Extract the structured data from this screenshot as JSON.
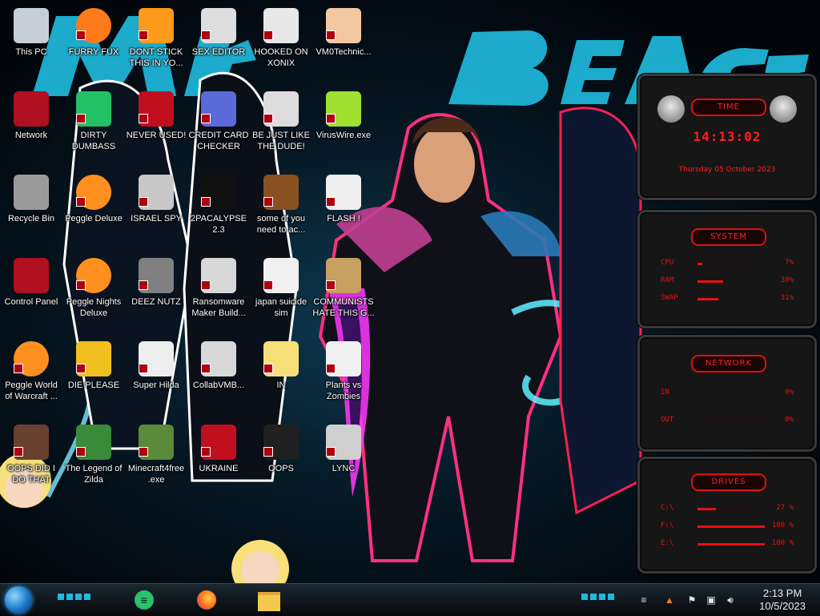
{
  "desktop": {
    "icons": [
      {
        "label": "This PC",
        "icon": "this-pc-icon"
      },
      {
        "label": "FURRY FUX",
        "icon": "firefox-icon"
      },
      {
        "label": "DONT STICK THIS IN YO...",
        "icon": "vlc-icon"
      },
      {
        "label": "SEX EDITOR",
        "icon": "hxd-icon"
      },
      {
        "label": "HOOKED ON XONIX",
        "icon": "xonix-icon"
      },
      {
        "label": "VM0Technic...",
        "icon": "doctor-icon"
      },
      {
        "label": "Network",
        "icon": "network-icon"
      },
      {
        "label": "DIRTY DUMBASS",
        "icon": "discord-icon"
      },
      {
        "label": "NEVER USED!",
        "icon": "devcpp-icon"
      },
      {
        "label": "CREDIT CARD CHECKER",
        "icon": "credit-card-icon"
      },
      {
        "label": "BE JUST LIKE THE DUDE!",
        "icon": "dude-icon"
      },
      {
        "label": "VirusWire.exe",
        "icon": "lime-icon"
      },
      {
        "label": "Recycle Bin",
        "icon": "recycle-bin-icon"
      },
      {
        "label": "Peggle Deluxe",
        "icon": "peggle-icon"
      },
      {
        "label": "ISRAEL SPY",
        "icon": "spy-icon"
      },
      {
        "label": "2PACALYPSE 2.3",
        "icon": "terminal-icon"
      },
      {
        "label": "some of you need to ac...",
        "icon": "beaver-icon"
      },
      {
        "label": "FLASH !",
        "icon": "flash-icon"
      },
      {
        "label": "Control Panel",
        "icon": "control-panel-icon"
      },
      {
        "label": "Peggle Nights Deluxe",
        "icon": "peggle-icon"
      },
      {
        "label": "DEEZ NUTZ",
        "icon": "windows-stack-icon"
      },
      {
        "label": "Ransomware Maker Build...",
        "icon": "window-app-icon"
      },
      {
        "label": "japan suicide sim",
        "icon": "document-icon"
      },
      {
        "label": "COMMUNISTS HATE THIS G...",
        "icon": "money-bag-icon"
      },
      {
        "label": "Peggle World of Warcraft ...",
        "icon": "peggle-icon"
      },
      {
        "label": "DIE PLEASE",
        "icon": "die-icon"
      },
      {
        "label": "Super Hilda",
        "icon": "pixel-cat-icon"
      },
      {
        "label": "CollabVMB...",
        "icon": "collabvm-icon"
      },
      {
        "label": "IN",
        "icon": "star-girl-icon"
      },
      {
        "label": "Plants vs Zombies",
        "icon": "plant-icon"
      },
      {
        "label": "OOPS DID I DO THAT",
        "icon": "portrait-icon"
      },
      {
        "label": "The Legend of Zilda",
        "icon": "zelda-icon"
      },
      {
        "label": "Minecraft4free .exe",
        "icon": "minecraft-icon"
      },
      {
        "label": "UKRAINE",
        "icon": "radiation-icon"
      },
      {
        "label": "OOPS",
        "icon": "oops-icon"
      },
      {
        "label": "LYNC",
        "icon": "lync-icon"
      }
    ]
  },
  "wallpaper": {
    "text": "MrBeast"
  },
  "rainmeter": {
    "time": {
      "title": "TIME",
      "clock": "14:13:02",
      "date": "Thursday 05 October 2023"
    },
    "system": {
      "title": "SYSTEM",
      "rows": [
        {
          "key": "CPU",
          "value": "7%",
          "level": 0.07
        },
        {
          "key": "RAM",
          "value": "38%",
          "level": 0.38
        },
        {
          "key": "SWAP",
          "value": "31%",
          "level": 0.31
        }
      ]
    },
    "network": {
      "title": "NETWORK",
      "rows": [
        {
          "key": "IN",
          "value": "0%"
        },
        {
          "key": "OUT",
          "value": "0%"
        }
      ]
    },
    "drives": {
      "title": "DRIVES",
      "rows": [
        {
          "key": "C:\\",
          "value": "27 %",
          "level": 0.27
        },
        {
          "key": "F:\\",
          "value": "100 %",
          "level": 1.0
        },
        {
          "key": "E:\\",
          "value": "100 %",
          "level": 1.0
        }
      ]
    }
  },
  "taskbar": {
    "pinned": [
      {
        "icon": "discord-icon"
      },
      {
        "icon": "firefox-icon"
      },
      {
        "icon": "file-explorer-icon"
      }
    ],
    "time": "2:13 PM",
    "date": "10/5/2023"
  },
  "colors": {
    "accent": "#e81010",
    "taskbar_accent": "#1fb8e0"
  }
}
